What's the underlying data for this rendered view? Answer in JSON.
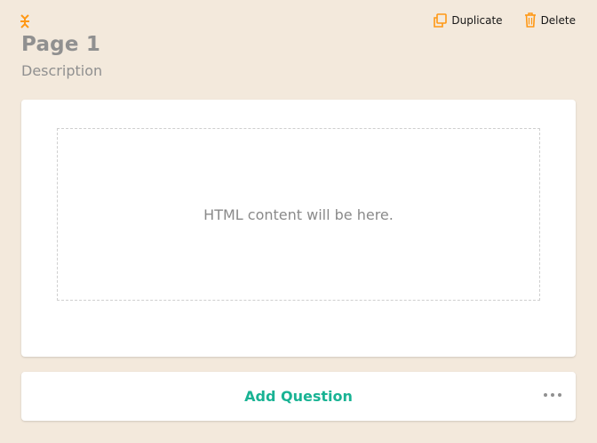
{
  "page": {
    "title": "Page 1",
    "description": "Description"
  },
  "actions": {
    "duplicate_label": "Duplicate",
    "delete_label": "Delete"
  },
  "html_question": {
    "placeholder_text": "HTML content will be here."
  },
  "add_question": {
    "label": "Add Question"
  },
  "icons": {
    "drag": "drag-handle-icon",
    "duplicate": "duplicate-icon",
    "delete": "trash-icon",
    "more": "more-dots-icon"
  },
  "colors": {
    "background": "#f3e9dc",
    "accent_orange": "#ff9814",
    "accent_green": "#19b394",
    "muted_text": "#909090"
  }
}
